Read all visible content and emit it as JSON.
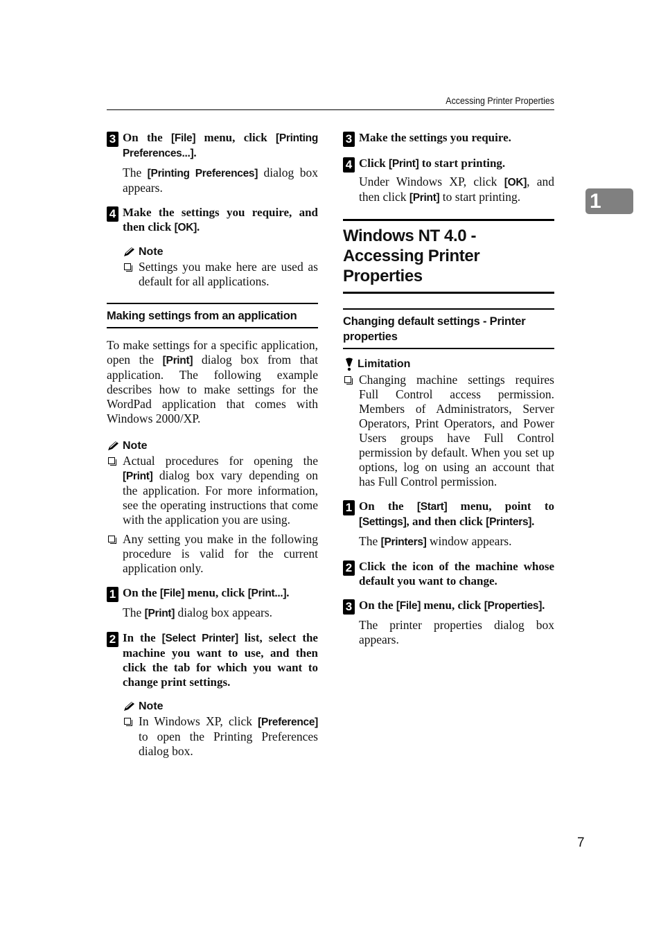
{
  "header": {
    "running_title": "Accessing Printer Properties"
  },
  "chapter_tab": "1",
  "page_number": "7",
  "left_column": {
    "step3": {
      "num": "3",
      "title_parts": [
        "On the ",
        "[File]",
        " menu, click ",
        "[Printing Preferences...]",
        "."
      ],
      "body_parts": [
        "The ",
        "[Printing Preferences]",
        " dialog box appears."
      ]
    },
    "step4": {
      "num": "4",
      "title_parts": [
        "Make the settings you require, and then click ",
        "[OK]",
        "."
      ],
      "note_label": "Note",
      "note_items": [
        "Settings you make here are used as default for all applications."
      ]
    },
    "section_heading": "Making settings from an application",
    "intro_parts": [
      "To make settings for a specific application, open the ",
      "[Print]",
      " dialog box from that application. The following example describes how to make settings for the WordPad application that comes with Windows 2000/XP."
    ],
    "note": {
      "label": "Note",
      "item1_parts": [
        "Actual procedures for opening the ",
        "[Print]",
        " dialog box vary depending on the application. For more information, see the operating instructions that come with the application you are using."
      ],
      "item2": "Any setting you make in the following procedure is valid for the current application only."
    },
    "stepA1": {
      "num": "1",
      "title_parts": [
        "On the ",
        "[File]",
        " menu, click ",
        "[Print...]",
        "."
      ],
      "body_parts": [
        "The ",
        "[Print]",
        " dialog box appears."
      ]
    },
    "stepA2": {
      "num": "2",
      "title_parts": [
        "In the ",
        "[Select Printer]",
        " list, select the machine you want to use, and then click the tab for which you want to change print settings."
      ],
      "note_label": "Note",
      "note_parts": [
        "In Windows XP, click ",
        "[Preference]",
        " to open the Printing Preferences dialog box."
      ]
    }
  },
  "right_column": {
    "stepA3": {
      "num": "3",
      "title": "Make the settings you require."
    },
    "stepA4": {
      "num": "4",
      "title_parts": [
        "Click ",
        "[Print]",
        " to start printing."
      ],
      "body_parts": [
        "Under Windows XP, click ",
        "[OK]",
        ", and then click ",
        "[Print]",
        " to start printing."
      ]
    },
    "section_big": "Windows NT 4.0 - Accessing Printer Properties",
    "section_small": "Changing default settings - Printer properties",
    "limitation": {
      "label": "Limitation",
      "item": "Changing machine settings requires Full Control access permission. Members of Administrators, Server Operators, Print Operators, and Power Users groups have Full Control permission by default. When you set up options, log on using an account that has Full Control permission."
    },
    "stepB1": {
      "num": "1",
      "title_parts": [
        "On the ",
        "[Start]",
        " menu, point to ",
        "[Settings]",
        ", and then click ",
        "[Printers]",
        "."
      ],
      "body_parts": [
        "The ",
        "[Printers]",
        " window appears."
      ]
    },
    "stepB2": {
      "num": "2",
      "title": "Click the icon of the machine whose default you want to change."
    },
    "stepB3": {
      "num": "3",
      "title_parts": [
        "On the ",
        "[File]",
        " menu, click ",
        "[Properties]",
        "."
      ],
      "body": "The printer properties dialog box appears."
    }
  }
}
